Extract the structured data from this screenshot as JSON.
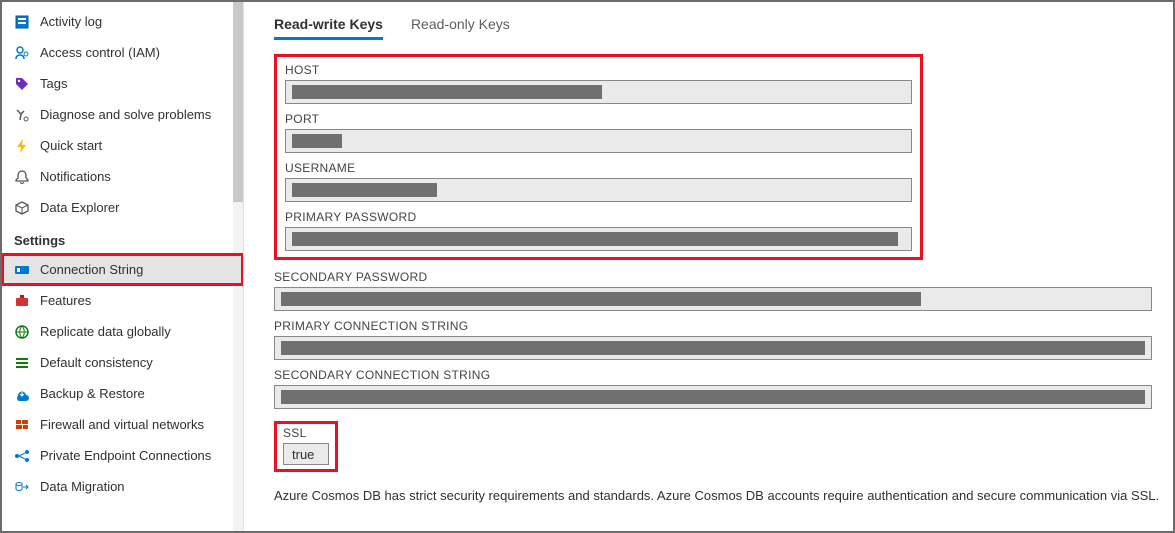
{
  "sidebar": {
    "group_top": [
      {
        "icon": "activity-log",
        "label": "Activity log"
      },
      {
        "icon": "access-control",
        "label": "Access control (IAM)"
      },
      {
        "icon": "tags",
        "label": "Tags"
      },
      {
        "icon": "diagnose",
        "label": "Diagnose and solve problems"
      },
      {
        "icon": "quick-start",
        "label": "Quick start"
      },
      {
        "icon": "notifications",
        "label": "Notifications"
      },
      {
        "icon": "data-explorer",
        "label": "Data Explorer"
      }
    ],
    "settings_header": "Settings",
    "group_settings": [
      {
        "icon": "connection-string",
        "label": "Connection String",
        "selected": true,
        "highlight": true
      },
      {
        "icon": "features",
        "label": "Features"
      },
      {
        "icon": "replicate",
        "label": "Replicate data globally"
      },
      {
        "icon": "consistency",
        "label": "Default consistency"
      },
      {
        "icon": "backup",
        "label": "Backup & Restore"
      },
      {
        "icon": "firewall",
        "label": "Firewall and virtual networks"
      },
      {
        "icon": "pe-connections",
        "label": "Private Endpoint Connections"
      },
      {
        "icon": "data-migration",
        "label": "Data Migration"
      }
    ]
  },
  "tabs": {
    "rw": "Read-write Keys",
    "ro": "Read-only Keys"
  },
  "fields": {
    "host": {
      "label": "HOST",
      "redact_width": 310
    },
    "port": {
      "label": "PORT",
      "redact_width": 50
    },
    "username": {
      "label": "USERNAME",
      "redact_width": 145
    },
    "primary_password": {
      "label": "PRIMARY PASSWORD",
      "redact_width": 606
    },
    "secondary_password": {
      "label": "SECONDARY PASSWORD",
      "redact_width": 640
    },
    "primary_conn": {
      "label": "PRIMARY CONNECTION STRING",
      "redact_width": 870
    },
    "secondary_conn": {
      "label": "SECONDARY CONNECTION STRING",
      "redact_width": 870
    },
    "ssl": {
      "label": "SSL",
      "value": "true"
    }
  },
  "footer_text": "Azure Cosmos DB has strict security requirements and standards. Azure Cosmos DB accounts require authentication and secure communication via SSL."
}
